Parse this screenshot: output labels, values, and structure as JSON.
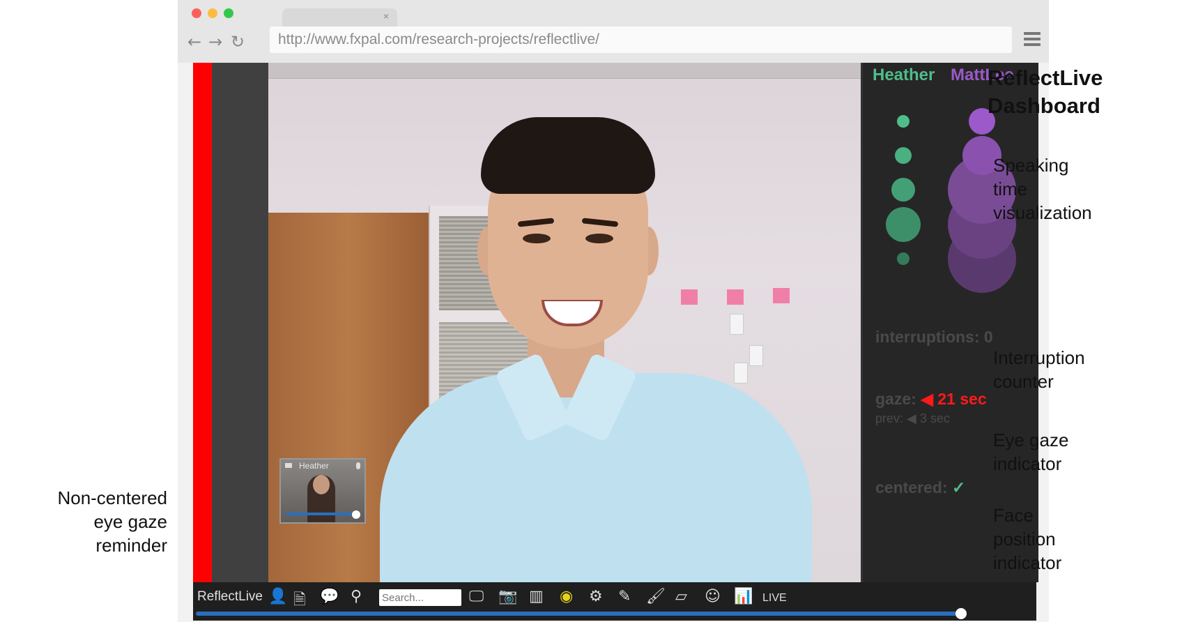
{
  "browser": {
    "url": "http://www.fxpal.com/research-projects/reflectlive/",
    "tab_close": "×",
    "back_icon": "←",
    "forward_icon": "→",
    "reload_icon": "↻"
  },
  "dashboard": {
    "participants": [
      {
        "name": "Heather",
        "color": "#4fbd8a"
      },
      {
        "name": "MattLee",
        "color": "#9b59c9"
      }
    ],
    "interruptions_label": "interruptions:",
    "interruptions_value": "0",
    "gaze_label": "gaze:",
    "gaze_value": "◀ 21 sec",
    "prev_label": "prev:",
    "prev_value": "◀ 3 sec",
    "centered_label": "centered:",
    "centered_value": "✓"
  },
  "video": {
    "thumbnail_label": "Heather"
  },
  "toolbar": {
    "brand": "ReflectLive",
    "search_placeholder": "Search...",
    "live_label": "LIVE",
    "icons": [
      "person-icon",
      "document-icon",
      "chat-icon",
      "search-icon",
      "monitor-icon",
      "camera-icon",
      "barcode-icon",
      "record-icon",
      "settings-icon",
      "pencil-icon",
      "brush-icon",
      "eraser-icon",
      "smiley-icon",
      "chart-icon"
    ]
  },
  "annotations": {
    "title_line1": "ReflectLive",
    "title_line2": "Dashboard",
    "speaking": [
      "Speaking",
      "time",
      "visualization"
    ],
    "interruption": [
      "Interruption",
      "counter"
    ],
    "eye_gaze": [
      "Eye gaze",
      "indicator"
    ],
    "face_position": [
      "Face",
      "position",
      "indicator"
    ],
    "non_centered": [
      "Non-centered",
      "eye gaze",
      "reminder"
    ]
  },
  "status_colors": {
    "gaze_warning": "#ff0000",
    "seek_bar": "#2a6fbf"
  }
}
